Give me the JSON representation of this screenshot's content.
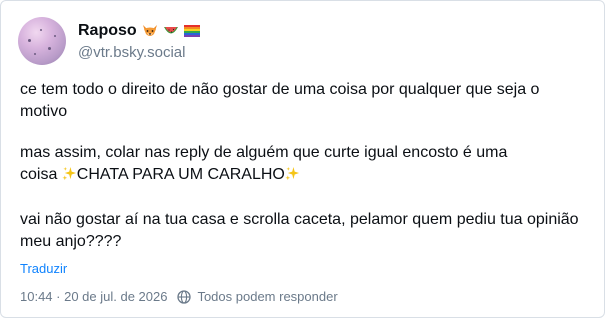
{
  "author": {
    "display_name": "Raposo",
    "handle": "@vtr.bsky.social",
    "name_emojis": [
      "fox-emoji",
      "watermelon-emoji",
      "rainbow-flag-emoji"
    ]
  },
  "post": {
    "paragraph1": "ce tem todo o direito de não gostar de uma coisa por qualquer que seja o motivo",
    "paragraph2_line1": "mas assim, colar nas reply de alguém que curte igual encosto é uma",
    "paragraph2_prefix": "coisa ",
    "paragraph2_highlight": "CHATA PARA UM CARALHO",
    "paragraph3": "vai não gostar aí na tua casa e scrolla caceta, pelamor quem pediu tua opinião meu anjo????"
  },
  "actions": {
    "translate_label": "Traduzir"
  },
  "meta": {
    "timestamp": "10:44 · 20 de jul. de 2026",
    "reply_setting": "Todos podem responder"
  },
  "colors": {
    "link": "#1083fe",
    "muted": "#6b7a8a",
    "border": "#d9dfe6"
  }
}
